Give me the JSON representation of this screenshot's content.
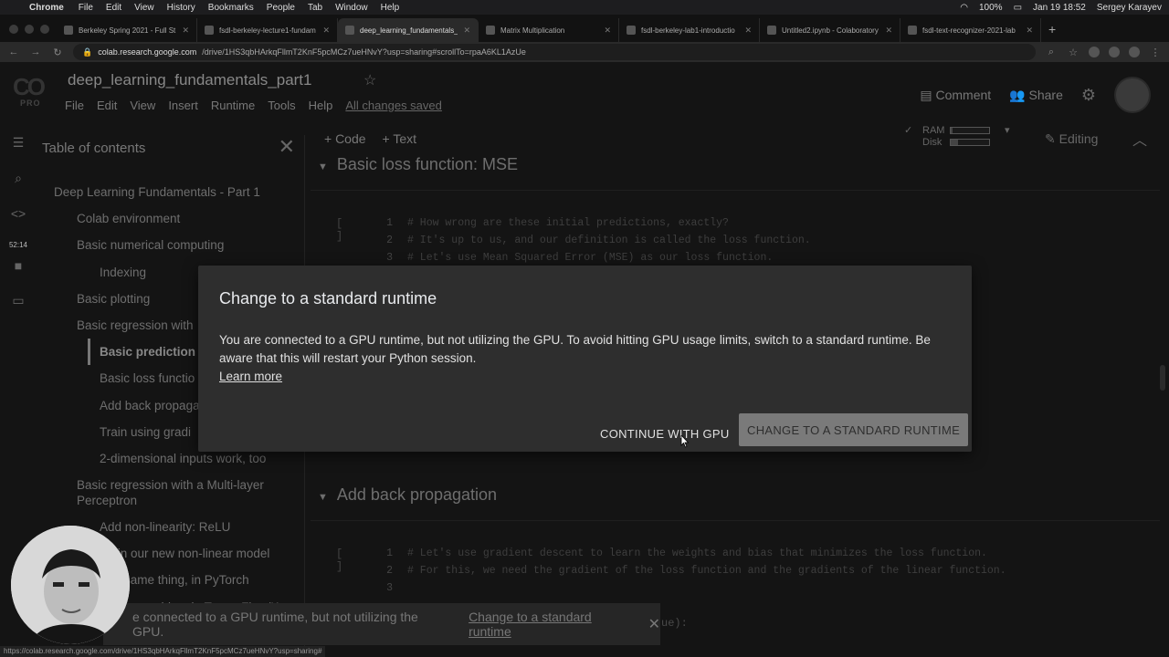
{
  "macos": {
    "app": "Chrome",
    "menus": [
      "File",
      "Edit",
      "View",
      "History",
      "Bookmarks",
      "People",
      "Tab",
      "Window",
      "Help"
    ],
    "battery": "100%",
    "datetime": "Jan 19  18:52",
    "user": "Sergey Karayev"
  },
  "browser": {
    "tabs": [
      {
        "title": "Berkeley Spring 2021 - Full St",
        "active": false
      },
      {
        "title": "fsdl-berkeley-lecture1-fundam",
        "active": false
      },
      {
        "title": "deep_learning_fundamentals_p",
        "active": true
      },
      {
        "title": "Matrix Multiplication",
        "active": false
      },
      {
        "title": "fsdl-berkeley-lab1-introductio",
        "active": false
      },
      {
        "title": "Untitled2.ipynb - Colaboratory",
        "active": false
      },
      {
        "title": "fsdl-text-recognizer-2021-lab",
        "active": false
      }
    ],
    "url_host": "colab.research.google.com",
    "url_path": "/drive/1HS3qbHArkqFllmT2KnF5pcMCz7ueHNvY?usp=sharing#scrollTo=rpaA6KL1AzUe"
  },
  "colab": {
    "logo": "CO",
    "logo_badge": "PRO",
    "title": "deep_learning_fundamentals_part1",
    "menus": [
      "File",
      "Edit",
      "View",
      "Insert",
      "Runtime",
      "Tools",
      "Help"
    ],
    "saved_status": "All changes saved",
    "comment": "Comment",
    "share": "Share",
    "add_code": "+ Code",
    "add_text": "+ Text",
    "ram": "RAM",
    "disk": "Disk",
    "ram_usage": 0.05,
    "disk_usage": 0.2,
    "editing": "Editing",
    "timer": "52:14"
  },
  "sidebar": {
    "title": "Table of contents",
    "items": [
      {
        "label": "Deep Learning Fundamentals - Part 1",
        "level": 0
      },
      {
        "label": "Colab environment",
        "level": 1
      },
      {
        "label": "Basic numerical computing",
        "level": 1
      },
      {
        "label": "Indexing",
        "level": 2
      },
      {
        "label": "Basic plotting",
        "level": 1
      },
      {
        "label": "Basic regression with",
        "level": 1
      },
      {
        "label": "Basic prediction",
        "level": 2,
        "active": true
      },
      {
        "label": "Basic loss functio",
        "level": 2
      },
      {
        "label": "Add back propaga",
        "level": 2
      },
      {
        "label": "Train using gradi",
        "level": 2
      },
      {
        "label": "2-dimensional inputs work, too",
        "level": 2
      },
      {
        "label": "Basic regression with a Multi-layer Perceptron",
        "level": 1,
        "two_line": true
      },
      {
        "label": "Add non-linearity: ReLU",
        "level": 2
      },
      {
        "label": "Train our new non-linear model",
        "level": 2
      },
      {
        "label": "The same thing, in PyTorch",
        "level": 2
      },
      {
        "label": "The same thing, in TensorFlow/Keras",
        "level": 2
      }
    ]
  },
  "notebook": {
    "section1": "Basic loss function: MSE",
    "cell1": [
      "# How wrong are these initial predictions, exactly?",
      "# It's up to us, and our definition is called the loss function.",
      "# Let's use Mean Squared Error (MSE) as our loss function."
    ],
    "section2": "Add back propagation",
    "cell2": [
      "# Let's use gradient descent to learn the weights and bias that minimizes the loss function.",
      "# For this, we need the gradient of the loss function and the gradients of the linear function.",
      ""
    ],
    "cell_run": "[ ]",
    "trailing_code": "ue):"
  },
  "dialog": {
    "title": "Change to a standard runtime",
    "body": "You are connected to a GPU runtime, but not utilizing the GPU. To avoid hitting GPU usage limits, switch to a standard runtime. Be aware that this will restart your Python session.",
    "learn_more": "Learn more",
    "continue": "CONTINUE WITH GPU",
    "change": "CHANGE TO A STANDARD RUNTIME"
  },
  "snackbar": {
    "text": "e connected to a GPU runtime, but not utilizing the GPU.",
    "link": "Change to a standard runtime"
  },
  "status_url": "https://colab.research.google.com/drive/1HS3qbHArkqFllmT2KnF5pcMCz7ueHNvY?usp=sharing#"
}
